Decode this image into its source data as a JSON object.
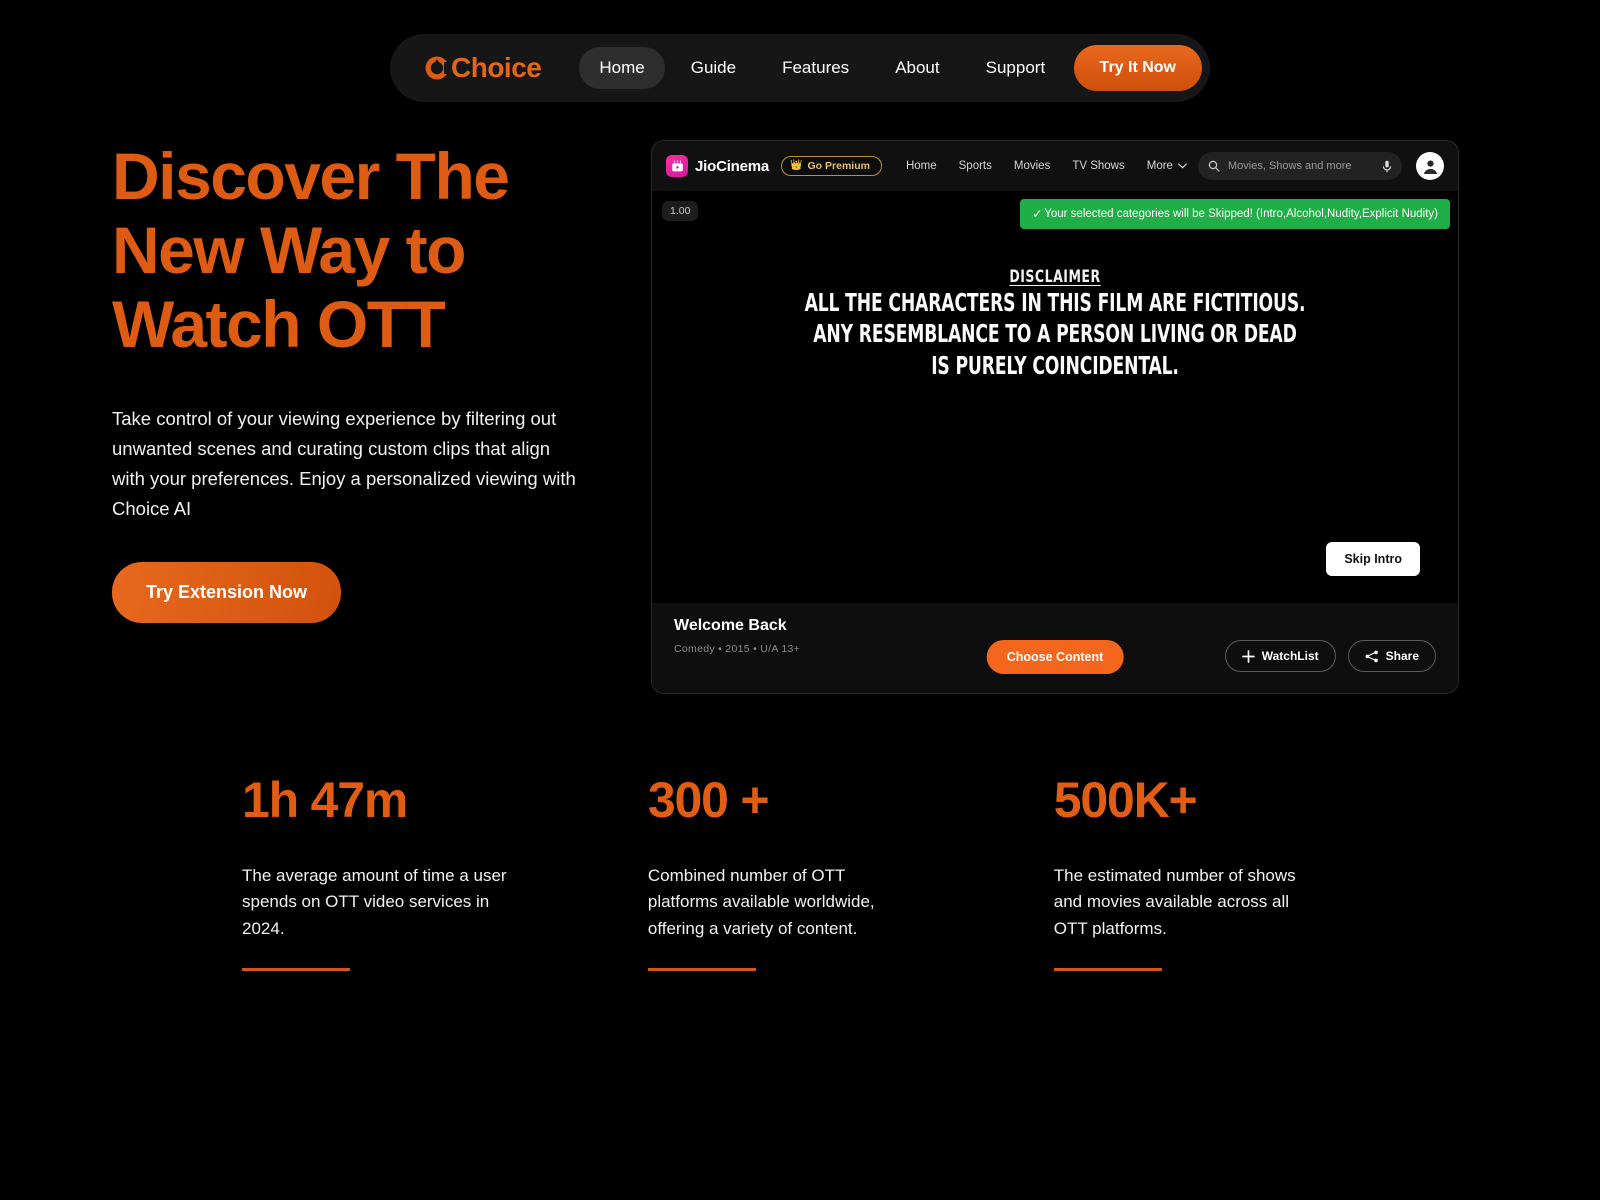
{
  "brand": {
    "name": "Choice",
    "accent": "#dd5b12",
    "logo_icon": "choice-c-icon"
  },
  "navbar": {
    "items": [
      {
        "label": "Home",
        "active": true
      },
      {
        "label": "Guide",
        "active": false
      },
      {
        "label": "Features",
        "active": false
      },
      {
        "label": "About",
        "active": false
      },
      {
        "label": "Support",
        "active": false
      }
    ],
    "cta_label": "Try It Now"
  },
  "hero": {
    "title_line1": "Discover The",
    "title_line2": "New Way to",
    "title_line3": "Watch OTT",
    "subtitle": "Take control of your viewing experience by filtering out unwanted scenes and curating custom clips that align with your preferences. Enjoy a personalized viewing with Choice AI",
    "cta_label": "Try Extension Now"
  },
  "player": {
    "header": {
      "app_name": "JioCinema",
      "premium_label": "Go Premium",
      "premium_icon": "crown-icon",
      "nav": [
        "Home",
        "Sports",
        "Movies",
        "TV Shows",
        "More"
      ],
      "more_icon": "chevron-down-icon",
      "search_placeholder": "Movies, Shows and more",
      "search_icon": "search-icon",
      "mic_icon": "microphone-icon",
      "avatar_icon": "user-avatar-icon"
    },
    "stage": {
      "speed_badge": "1.00",
      "toast_check": "✓",
      "toast_text": "Your selected categories will be Skipped! (Intro,Alcohol,Nudity,Explicit Nudity)",
      "toast_color": "#1faf46",
      "disclaimer_heading": "DISCLAIMER",
      "disclaimer_line1": "ALL THE CHARACTERS IN THIS FILM ARE FICTITIOUS.",
      "disclaimer_line2": "ANY RESEMBLANCE TO A PERSON LIVING OR DEAD",
      "disclaimer_line3": "IS PURELY COINCIDENTAL.",
      "skip_intro_label": "Skip Intro"
    },
    "bottom": {
      "title": "Welcome Back",
      "meta": "Comedy  •  2015  •  U/A 13+",
      "choose_content_label": "Choose Content",
      "watchlist_label": "WatchList",
      "watchlist_icon": "plus-icon",
      "share_label": "Share",
      "share_icon": "share-icon"
    }
  },
  "stats": [
    {
      "value": "1h 47m",
      "description": "The average amount of time a user spends on OTT video services in 2024."
    },
    {
      "value": "300 +",
      "description": "Combined number of OTT platforms available worldwide, offering a variety of content."
    },
    {
      "value": "500K+",
      "description": "The estimated number of shows and movies available across all OTT platforms."
    }
  ]
}
